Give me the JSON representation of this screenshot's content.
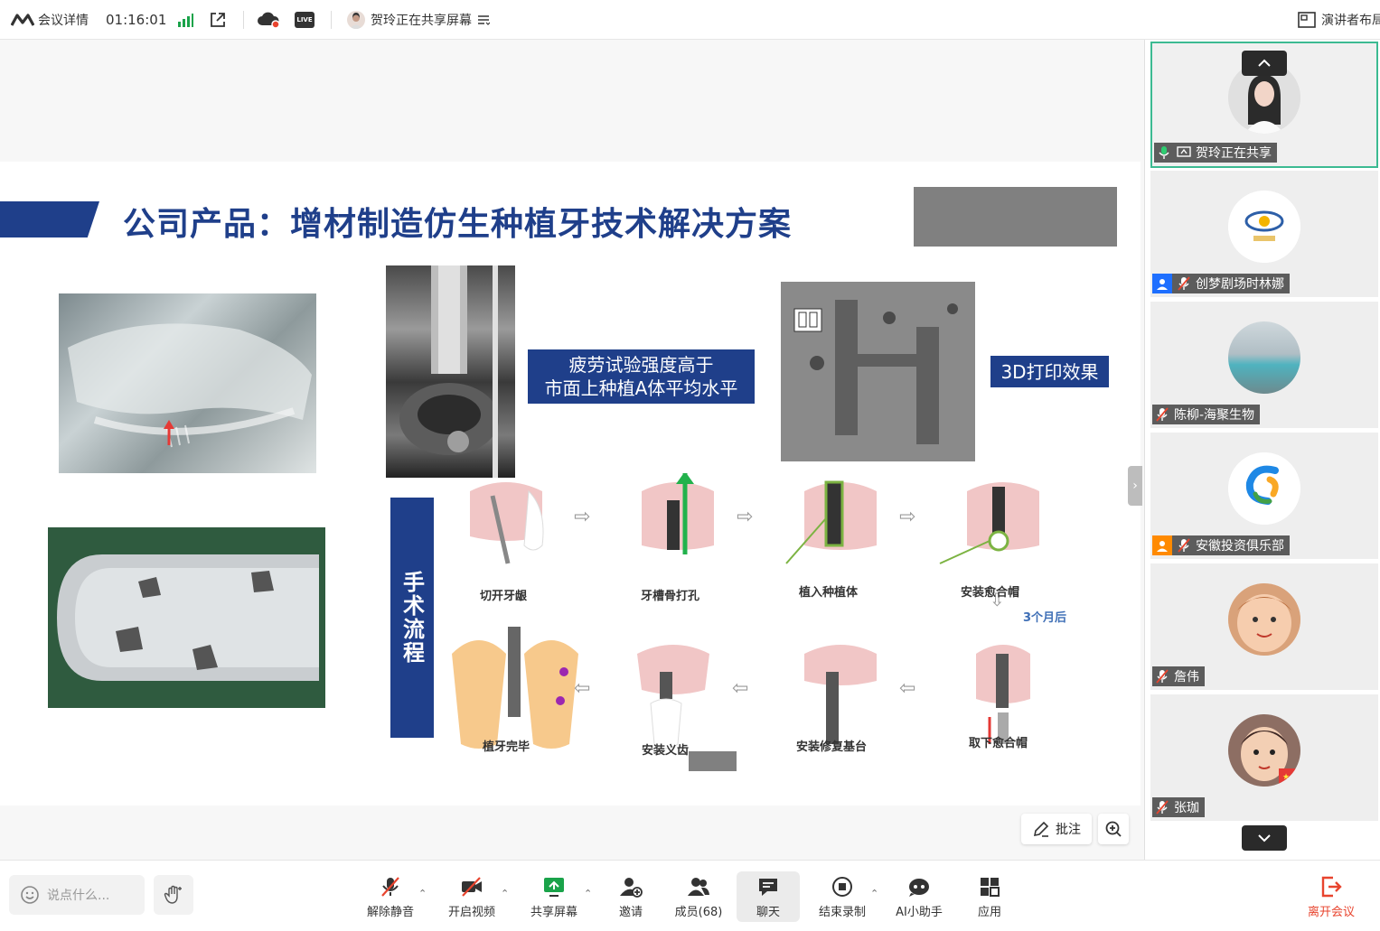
{
  "topbar": {
    "meeting_details": "会议详情",
    "timer": "01:16:01",
    "sharer_status": "贺玲正在共享屏幕",
    "live_badge": "LIVE",
    "presenter_layout": "演讲者布局"
  },
  "slide": {
    "title": "公司产品：增材制造仿生种植牙技术解决方案",
    "caption_fatigue_line1": "疲劳试验强度高于",
    "caption_fatigue_line2": "市面上种植A体平均水平",
    "caption_3d": "3D打印效果",
    "surgery_flow": "手术流程",
    "steps": [
      "切开牙龈",
      "牙槽骨打孔",
      "植入种植体",
      "安装愈合帽",
      "取下愈合帽",
      "安装修复基台",
      "安装义齿",
      "植牙完毕"
    ],
    "three_months_later": "3个月后"
  },
  "participants": [
    {
      "name": "贺玲正在共享"
    },
    {
      "name": "创梦剧场时林娜"
    },
    {
      "name": "陈柳-海聚生物"
    },
    {
      "name": "安徽投资俱乐部"
    },
    {
      "name": "詹伟"
    },
    {
      "name": "张珈"
    }
  ],
  "annotate": {
    "label": "批注"
  },
  "toolbar": {
    "chat_placeholder": "说点什么...",
    "unmute": "解除静音",
    "start_video": "开启视频",
    "share_screen": "共享屏幕",
    "invite": "邀请",
    "members": "成员(68)",
    "chat": "聊天",
    "end_recording": "结束录制",
    "ai_assistant": "AI小助手",
    "apps": "应用",
    "leave": "离开会议"
  },
  "colors": {
    "brand_blue": "#1f3f8a",
    "active_green": "#3cba92",
    "leave_red": "#e8442e",
    "signal_green": "#1aa34a"
  }
}
